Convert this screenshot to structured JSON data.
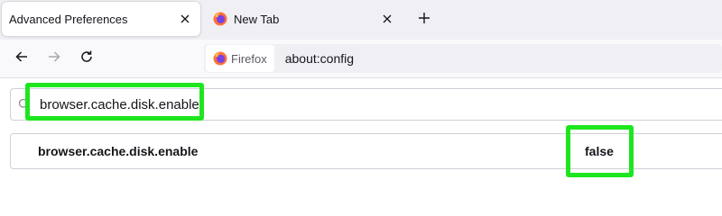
{
  "tabs": [
    {
      "title": "Advanced Preferences",
      "active": true
    },
    {
      "title": "New Tab",
      "active": false
    }
  ],
  "navbar": {
    "identity_label": "Firefox",
    "url": "about:config"
  },
  "search": {
    "value": "browser.cache.disk.enable"
  },
  "preference": {
    "name": "browser.cache.disk.enable",
    "value": "false"
  },
  "colors": {
    "highlight": "#1ee61e",
    "tabstrip_bg": "#f0f0f4"
  },
  "icons": [
    "close-icon",
    "firefox-logo-icon",
    "plus-icon",
    "back-arrow-icon",
    "forward-arrow-icon",
    "reload-icon",
    "search-icon"
  ]
}
